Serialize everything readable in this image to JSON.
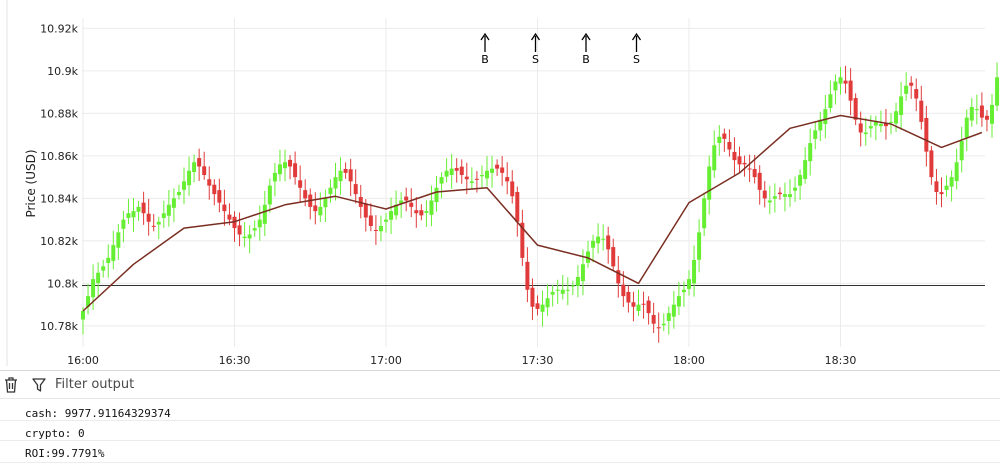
{
  "chart_data": {
    "type": "candlestick",
    "ylabel": "Price (USD)",
    "ylim": [
      10.771,
      10.923
    ],
    "y_ticks": [
      10.78,
      10.8,
      10.82,
      10.84,
      10.86,
      10.88,
      10.9,
      10.92
    ],
    "y_tick_labels": [
      "10.78k",
      "10.8k",
      "10.82k",
      "10.84k",
      "10.86k",
      "10.88k",
      "10.9k",
      "10.92k"
    ],
    "x_range_minutes": [
      0,
      178
    ],
    "x_ticks": [
      0,
      30,
      60,
      90,
      120,
      150
    ],
    "x_tick_labels": [
      "16:00",
      "16:30",
      "17:00",
      "17:30",
      "18:00",
      "18:30"
    ],
    "unit": "k USD",
    "horizontal_line": 10.799,
    "colors": {
      "up": "#66ee33",
      "down": "#e03a3a",
      "ma": "#7a2e22",
      "hline": "#333333"
    },
    "candles_start": "16:00",
    "candle_interval_minutes": 1,
    "closes": [
      10.787,
      10.794,
      10.802,
      10.805,
      10.808,
      10.812,
      10.818,
      10.824,
      10.83,
      10.833,
      10.834,
      10.836,
      10.833,
      10.829,
      10.827,
      10.829,
      10.833,
      10.837,
      10.84,
      10.843,
      10.848,
      10.853,
      10.857,
      10.855,
      10.851,
      10.846,
      10.842,
      10.838,
      10.834,
      10.83,
      10.826,
      10.823,
      10.822,
      10.823,
      10.826,
      10.83,
      10.837,
      10.846,
      10.852,
      10.856,
      10.857,
      10.855,
      10.85,
      10.845,
      10.84,
      10.836,
      10.834,
      10.836,
      10.84,
      10.845,
      10.85,
      10.853,
      10.852,
      10.848,
      10.842,
      10.836,
      10.831,
      10.827,
      10.825,
      10.827,
      10.83,
      10.834,
      10.837,
      10.839,
      10.839,
      10.836,
      10.833,
      10.832,
      10.834,
      10.839,
      10.845,
      10.85,
      10.853,
      10.854,
      10.853,
      10.851,
      10.849,
      10.848,
      10.849,
      10.851,
      10.853,
      10.854,
      10.854,
      10.852,
      10.848,
      10.841,
      10.829,
      10.812,
      10.797,
      10.789,
      10.788,
      10.79,
      10.793,
      10.796,
      10.797,
      10.797,
      10.797,
      10.799,
      10.803,
      10.809,
      10.815,
      10.82,
      10.822,
      10.821,
      10.816,
      10.808,
      10.8,
      10.794,
      10.791,
      10.789,
      10.79,
      10.79,
      10.786,
      10.781,
      10.779,
      10.781,
      10.786,
      10.79,
      10.794,
      10.797,
      10.802,
      10.811,
      10.824,
      10.84,
      10.855,
      10.865,
      10.869,
      10.868,
      10.863,
      10.858,
      10.856,
      10.856,
      10.854,
      10.85,
      10.844,
      10.84,
      10.839,
      10.841,
      10.842,
      10.842,
      10.842,
      10.845,
      10.851,
      10.858,
      10.866,
      10.872,
      10.877,
      10.882,
      10.889,
      10.895,
      10.897,
      10.894,
      10.886,
      10.877,
      10.871,
      10.871,
      10.874,
      10.876,
      10.875,
      10.874,
      10.876,
      10.881,
      10.888,
      10.893,
      10.893,
      10.887,
      10.876,
      10.862,
      10.85,
      10.843,
      10.842,
      10.846,
      10.85,
      10.857,
      10.867,
      10.878,
      10.883,
      10.882,
      10.878,
      10.877,
      10.884,
      10.897
    ],
    "moving_average": {
      "x": [
        0,
        10,
        20,
        30,
        40,
        50,
        60,
        70,
        80,
        90,
        100,
        110,
        120,
        130,
        140,
        150,
        160,
        170,
        178
      ],
      "y": [
        10.787,
        10.809,
        10.826,
        10.829,
        10.837,
        10.841,
        10.835,
        10.843,
        10.845,
        10.818,
        10.812,
        10.8,
        10.838,
        10.852,
        10.873,
        10.879,
        10.875,
        10.864,
        10.871
      ]
    }
  },
  "trade_markers": [
    {
      "label": "B",
      "x_minute": 80
    },
    {
      "label": "S",
      "x_minute": 90
    },
    {
      "label": "B",
      "x_minute": 100
    },
    {
      "label": "S",
      "x_minute": 110
    }
  ],
  "toolbar": {
    "filter_label": "Filter output",
    "trash_icon": "trash-icon",
    "filter_icon": "filter-icon"
  },
  "output": {
    "lines": [
      "cash: 9977.91164329374",
      "crypto: 0",
      "ROI:99.7791%"
    ]
  }
}
